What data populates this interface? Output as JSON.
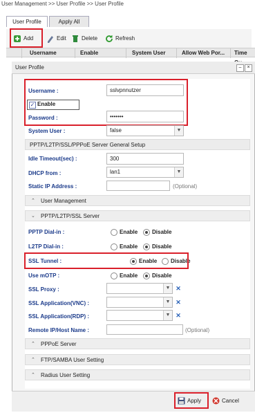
{
  "breadcrumb": "User Management >> User Profile >> User Profile",
  "tabs": [
    "User Profile",
    "Apply All"
  ],
  "toolbar": {
    "add": "Add",
    "edit": "Edit",
    "delete": "Delete",
    "refresh": "Refresh"
  },
  "grid_headers": [
    "Username",
    "Enable",
    "System User",
    "Allow Web Por...",
    "Time Qu"
  ],
  "dialog": {
    "title": "User Profile",
    "username_label": "Username :",
    "username_value": "sslvpnnutzer",
    "enable_label": "Enable",
    "enable_checked": true,
    "password_label": "Password :",
    "password_value": "•••••••",
    "system_user_label": "System User :",
    "system_user_value": "false",
    "general_section": "PPTP/L2TP/SSL/PPPoE Server General Setup",
    "idle_timeout_label": "Idle Timeout(sec) :",
    "idle_timeout_value": "300",
    "dhcp_from_label": "DHCP from :",
    "dhcp_from_value": "lan1",
    "static_ip_label": "Static IP Address :",
    "static_ip_hint": "(Optional)",
    "user_mgmt_section": "User Management",
    "pptp_section": "PPTP/L2TP/SSL Server",
    "pptp_dialin_label": "PPTP Dial-in :",
    "l2tp_dialin_label": "L2TP Dial-in :",
    "ssl_tunnel_label": "SSL Tunnel :",
    "use_motp_label": "Use mOTP :",
    "enable_text": "Enable",
    "disable_text": "Disable",
    "ssl_proxy_label": "SSL Proxy :",
    "ssl_vnc_label": "SSL Application(VNC) :",
    "ssl_rdp_label": "SSL Application(RDP) :",
    "remote_ip_label": "Remote IP/Host Name :",
    "remote_ip_hint": "(Optional)",
    "pppoe_section": "PPPoE Server",
    "ftp_section": "FTP/SAMBA User Setting",
    "radius_section": "Radius User Setting",
    "apply": "Apply",
    "cancel": "Cancel"
  },
  "colors": {
    "highlight": "#d91f2a",
    "label": "#1a3a8a"
  }
}
